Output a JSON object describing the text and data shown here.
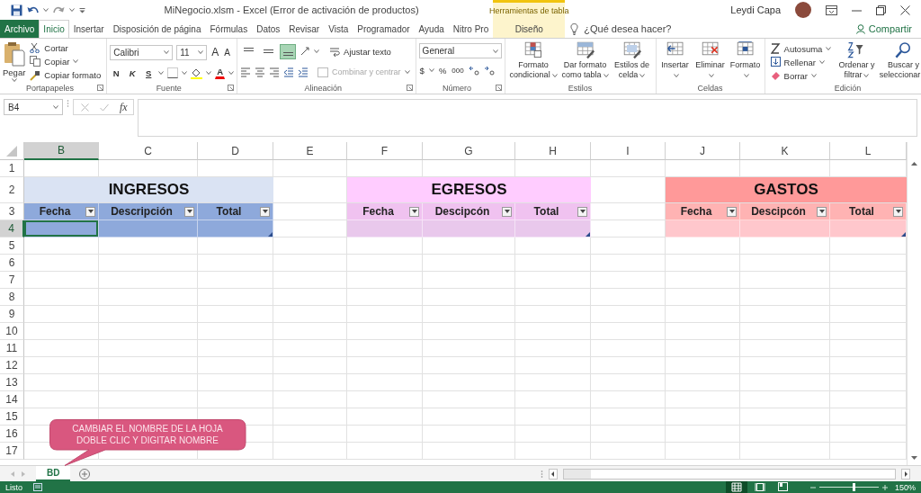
{
  "window": {
    "title": "MiNegocio.xlsm - Excel (Error de activación de productos)",
    "user": "Leydi Capa"
  },
  "contextual_group": "Herramientas de tabla",
  "tabs": [
    {
      "label": "Archivo",
      "kind": "file",
      "selected": false
    },
    {
      "label": "Inicio",
      "kind": "normal",
      "selected": true
    },
    {
      "label": "Insertar",
      "kind": "normal",
      "selected": false
    },
    {
      "label": "Disposición de página",
      "kind": "normal",
      "selected": false
    },
    {
      "label": "Fórmulas",
      "kind": "normal",
      "selected": false
    },
    {
      "label": "Datos",
      "kind": "normal",
      "selected": false
    },
    {
      "label": "Revisar",
      "kind": "normal",
      "selected": false
    },
    {
      "label": "Vista",
      "kind": "normal",
      "selected": false
    },
    {
      "label": "Programador",
      "kind": "normal",
      "selected": false
    },
    {
      "label": "Ayuda",
      "kind": "normal",
      "selected": false
    },
    {
      "label": "Nitro Pro",
      "kind": "normal",
      "selected": false
    },
    {
      "label": "Diseño",
      "kind": "contextual",
      "selected": false
    }
  ],
  "tell_me": "¿Qué desea hacer?",
  "share": "Compartir",
  "ribbon": {
    "groups": [
      {
        "kind": "clipboard",
        "label": "Portapapeles",
        "big": "Pegar",
        "small": [
          "Cortar",
          "Copiar",
          "Copiar formato"
        ]
      },
      {
        "kind": "font",
        "label": "Fuente",
        "font_name": "Calibri",
        "font_size": "11",
        "size_buttons": [
          "A",
          "A"
        ],
        "styles": [
          "N",
          "K",
          "S"
        ],
        "font_color": "A"
      },
      {
        "kind": "alignment",
        "label": "Alineación",
        "align_buttons": [
          {
            "selected": false
          },
          {
            "selected": false
          },
          {
            "selected": true
          }
        ],
        "wrap": "Ajustar texto",
        "merge": {
          "label": "Combinar y centrar",
          "disabled": true
        }
      },
      {
        "kind": "number",
        "label": "Número",
        "format": "General",
        "symbols": [
          "$",
          "%",
          "000"
        ]
      },
      {
        "kind": "styles",
        "label": "Estilos",
        "buttons": [
          "Formato condicional",
          "Dar formato como tabla",
          "Estilos de celda"
        ]
      },
      {
        "kind": "cells",
        "label": "Celdas",
        "buttons": [
          "Insertar",
          "Eliminar",
          "Formato"
        ]
      },
      {
        "kind": "editing",
        "label": "Edición",
        "small": [
          "Autosuma",
          "Rellenar",
          "Borrar"
        ],
        "buttons": [
          "Ordenar y filtrar",
          "Buscar y seleccionar"
        ]
      }
    ]
  },
  "formula_bar": {
    "name_box": "B4",
    "function_label": "fx"
  },
  "sheet": {
    "columns": [
      {
        "label": "B",
        "selected": true
      },
      {
        "label": "C",
        "selected": false
      },
      {
        "label": "D",
        "selected": false
      },
      {
        "label": "E",
        "selected": false
      },
      {
        "label": "F",
        "selected": false
      },
      {
        "label": "G",
        "selected": false
      },
      {
        "label": "H",
        "selected": false
      },
      {
        "label": "I",
        "selected": false
      },
      {
        "label": "J",
        "selected": false
      },
      {
        "label": "K",
        "selected": false
      },
      {
        "label": "L",
        "selected": false
      }
    ],
    "rows": [
      {
        "label": "1",
        "selected": false
      },
      {
        "label": "2",
        "selected": false
      },
      {
        "label": "3",
        "selected": false
      },
      {
        "label": "4",
        "selected": true
      },
      {
        "label": "5",
        "selected": false
      },
      {
        "label": "6",
        "selected": false
      },
      {
        "label": "7",
        "selected": false
      },
      {
        "label": "8",
        "selected": false
      },
      {
        "label": "9",
        "selected": false
      },
      {
        "label": "10",
        "selected": false
      },
      {
        "label": "11",
        "selected": false
      },
      {
        "label": "12",
        "selected": false
      },
      {
        "label": "13",
        "selected": false
      },
      {
        "label": "14",
        "selected": false
      },
      {
        "label": "15",
        "selected": false
      },
      {
        "label": "16",
        "selected": false
      },
      {
        "label": "17",
        "selected": false
      }
    ],
    "tables": [
      {
        "title": "INGRESOS",
        "color": "#dae3f3",
        "header_row": {
          "color": "#8ea9db",
          "columns": [
            "Fecha",
            "Descripción",
            "Total"
          ]
        },
        "data_row": {
          "color": "#8ea9db",
          "cells": [
            {
              "selected": true
            },
            {
              "selected": false
            },
            {
              "selected": false
            }
          ]
        }
      },
      {
        "title": "EGRESOS",
        "color": "#ffccff",
        "header_row": {
          "color": "#f0c2f0",
          "columns": [
            "Fecha",
            "Descipcón",
            "Total"
          ]
        },
        "data_row": {
          "color": "#e9c8ec",
          "cells": [
            {
              "selected": false
            },
            {
              "selected": false
            },
            {
              "selected": false
            }
          ]
        }
      },
      {
        "title": "GASTOS",
        "color": "#ff9999",
        "header_row": {
          "color": "#ffb3b3",
          "columns": [
            "Fecha",
            "Descipcón",
            "Total"
          ]
        },
        "data_row": {
          "color": "#ffc7cc",
          "cells": [
            {
              "selected": false
            },
            {
              "selected": false
            },
            {
              "selected": false
            }
          ]
        }
      }
    ]
  },
  "callout": {
    "lines": [
      "CAMBIAR EL NOMBRE DE LA HOJA",
      "DOBLE CLIC Y DIGITAR NOMBRE"
    ]
  },
  "sheet_tabs": [
    {
      "label": "BD",
      "selected": true
    }
  ],
  "status_bar": {
    "status": "Listo",
    "views": [
      {
        "selected": true
      },
      {
        "selected": false
      },
      {
        "selected": false
      }
    ],
    "zoom": {
      "level": 0.58
    },
    "zoom_label": "150%"
  }
}
